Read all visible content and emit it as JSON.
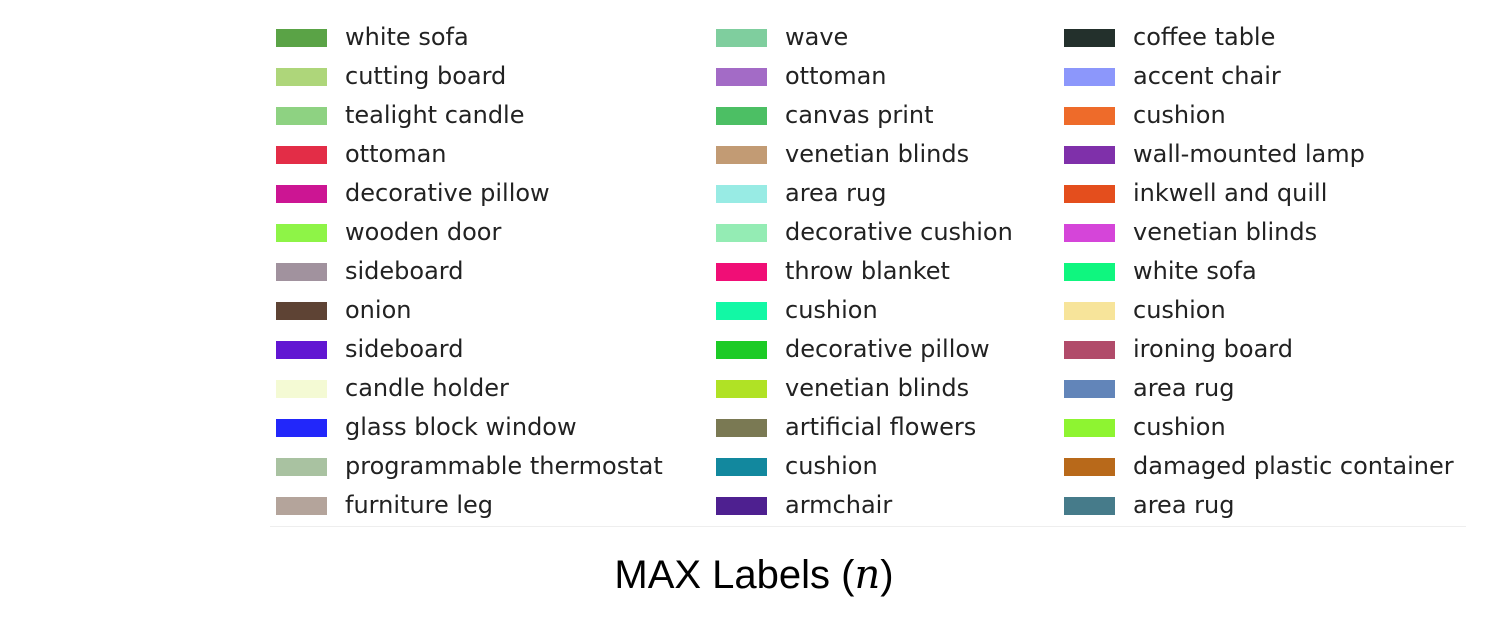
{
  "legend": {
    "columns": [
      [
        {
          "label": "white sofa",
          "color": "#5aa346"
        },
        {
          "label": "cutting board",
          "color": "#aed67a"
        },
        {
          "label": "tealight candle",
          "color": "#8ed282"
        },
        {
          "label": "ottoman",
          "color": "#e32d47"
        },
        {
          "label": "decorative pillow",
          "color": "#cc1593"
        },
        {
          "label": "wooden door",
          "color": "#8ef447"
        },
        {
          "label": "sideboard",
          "color": "#a1929e"
        },
        {
          "label": "onion",
          "color": "#5e4334"
        },
        {
          "label": "sideboard",
          "color": "#6116d2"
        },
        {
          "label": "candle holder",
          "color": "#f4fad4"
        },
        {
          "label": "glass block window",
          "color": "#2227fa"
        },
        {
          "label": "programmable thermostat",
          "color": "#a9c2a1"
        },
        {
          "label": "furniture leg",
          "color": "#b4a49b"
        }
      ],
      [
        {
          "label": "wave",
          "color": "#7fce9e"
        },
        {
          "label": "ottoman",
          "color": "#a36bc6"
        },
        {
          "label": "canvas print",
          "color": "#4cbf64"
        },
        {
          "label": "venetian blinds",
          "color": "#c29b74"
        },
        {
          "label": "area rug",
          "color": "#98ebe4"
        },
        {
          "label": "decorative cushion",
          "color": "#94ecb4"
        },
        {
          "label": "throw blanket",
          "color": "#f00e76"
        },
        {
          "label": "cushion",
          "color": "#12f8a5"
        },
        {
          "label": "decorative pillow",
          "color": "#1ccb26"
        },
        {
          "label": "venetian blinds",
          "color": "#b0e225"
        },
        {
          "label": "artificial flowers",
          "color": "#7a7953"
        },
        {
          "label": "cushion",
          "color": "#12889e"
        },
        {
          "label": "armchair",
          "color": "#4e2090"
        }
      ],
      [
        {
          "label": "coffee table",
          "color": "#23302c"
        },
        {
          "label": "accent chair",
          "color": "#8c97fb"
        },
        {
          "label": "cushion",
          "color": "#ee6b2a"
        },
        {
          "label": "wall-mounted lamp",
          "color": "#7f30aa"
        },
        {
          "label": "inkwell and quill",
          "color": "#e44e1d"
        },
        {
          "label": "venetian blinds",
          "color": "#d545d9"
        },
        {
          "label": "white sofa",
          "color": "#0ff67f"
        },
        {
          "label": "cushion",
          "color": "#f7e49a"
        },
        {
          "label": "ironing board",
          "color": "#b14b6a"
        },
        {
          "label": "area rug",
          "color": "#6285b9"
        },
        {
          "label": "cushion",
          "color": "#8ef431"
        },
        {
          "label": "damaged plastic container",
          "color": "#b8691a"
        },
        {
          "label": "area rug",
          "color": "#467b8a"
        }
      ]
    ]
  },
  "caption": {
    "text": "MAX Labels (",
    "math": "n",
    "close": ")"
  }
}
